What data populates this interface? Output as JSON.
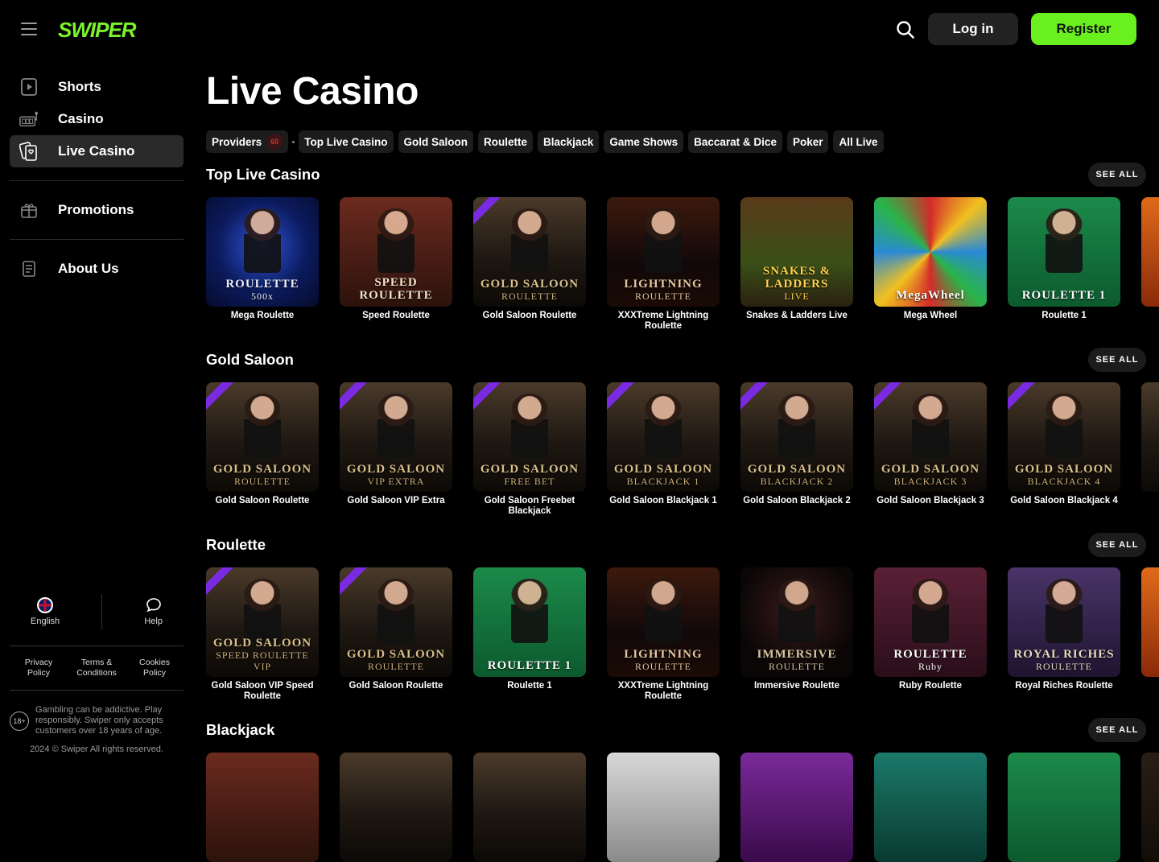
{
  "brand": {
    "logo": "SWIPER"
  },
  "sidebar": {
    "items": [
      {
        "label": "Shorts",
        "icon": "play-square-icon"
      },
      {
        "label": "Casino",
        "icon": "slot-machine-icon"
      },
      {
        "label": "Live Casino",
        "icon": "cards-icon",
        "active": true
      },
      {
        "label": "Promotions",
        "icon": "gift-icon"
      },
      {
        "label": "About Us",
        "icon": "document-icon"
      }
    ],
    "language": "English",
    "help": "Help",
    "privacy": "Privacy Policy",
    "terms": "Terms & Conditions",
    "cookies": "Cookies Policy",
    "age_badge": "18+",
    "disclaimer": "Gambling can be addictive. Play responsibly. Swiper only accepts customers over 18 years of age.",
    "copyright": "2024 © Swiper All rights reserved."
  },
  "header": {
    "login": "Log in",
    "register": "Register"
  },
  "page": {
    "title": "Live Casino",
    "chips": [
      "Providers",
      "Top Live Casino",
      "Gold Saloon",
      "Roulette",
      "Blackjack",
      "Game Shows",
      "Baccarat & Dice",
      "Poker",
      "All Live"
    ],
    "providers_badge": "60"
  },
  "see_all": "SEE ALL",
  "sections": [
    {
      "title": "Top Live Casino",
      "games": [
        {
          "label": "Mega Roulette",
          "art1": "ROULETTE",
          "art2": "500x",
          "theme": "g-blue"
        },
        {
          "label": "Speed Roulette",
          "art1": "SPEED ROULETTE",
          "art2": "",
          "theme": "g-red"
        },
        {
          "label": "Gold Saloon Roulette",
          "art1": "GOLD SALOON",
          "art2": "ROULETTE",
          "theme": "g-gold",
          "exclusive": true
        },
        {
          "label": "XXXTreme Lightning Roulette",
          "art1": "LIGHTNING",
          "art2": "ROULETTE",
          "theme": "g-fire"
        },
        {
          "label": "Snakes & Ladders Live",
          "art1": "SNAKES & LADDERS",
          "art2": "LIVE",
          "theme": "g-snake"
        },
        {
          "label": "Mega Wheel",
          "art1": "MegaWheel",
          "art2": "",
          "theme": "g-wheel"
        },
        {
          "label": "Roulette 1",
          "art1": "ROULETTE 1",
          "art2": "",
          "theme": "g-green"
        }
      ]
    },
    {
      "title": "Gold Saloon",
      "games": [
        {
          "label": "Gold Saloon Roulette",
          "art1": "GOLD SALOON",
          "art2": "ROULETTE",
          "theme": "g-gold",
          "exclusive": true
        },
        {
          "label": "Gold Saloon VIP Extra",
          "art1": "GOLD SALOON",
          "art2": "VIP EXTRA",
          "theme": "g-gold",
          "exclusive": true
        },
        {
          "label": "Gold Saloon Freebet Blackjack",
          "art1": "GOLD SALOON",
          "art2": "FREE BET",
          "theme": "g-gold",
          "exclusive": true
        },
        {
          "label": "Gold Saloon Blackjack 1",
          "art1": "GOLD SALOON",
          "art2": "BLACKJACK 1",
          "theme": "g-gold",
          "exclusive": true
        },
        {
          "label": "Gold Saloon Blackjack 2",
          "art1": "GOLD SALOON",
          "art2": "BLACKJACK 2",
          "theme": "g-gold",
          "exclusive": true
        },
        {
          "label": "Gold Saloon Blackjack 3",
          "art1": "GOLD SALOON",
          "art2": "BLACKJACK 3",
          "theme": "g-gold",
          "exclusive": true
        },
        {
          "label": "Gold Saloon Blackjack 4",
          "art1": "GOLD SALOON",
          "art2": "BLACKJACK 4",
          "theme": "g-gold",
          "exclusive": true
        }
      ]
    },
    {
      "title": "Roulette",
      "games": [
        {
          "label": "Gold Saloon VIP Speed Roulette",
          "art1": "GOLD SALOON",
          "art2": "SPEED ROULETTE VIP",
          "theme": "g-gold",
          "exclusive": true
        },
        {
          "label": "Gold Saloon Roulette",
          "art1": "GOLD SALOON",
          "art2": "ROULETTE",
          "theme": "g-gold",
          "exclusive": true
        },
        {
          "label": "Roulette 1",
          "art1": "ROULETTE 1",
          "art2": "",
          "theme": "g-green"
        },
        {
          "label": "XXXTreme Lightning Roulette",
          "art1": "LIGHTNING",
          "art2": "ROULETTE",
          "theme": "g-fire"
        },
        {
          "label": "Immersive Roulette",
          "art1": "IMMERSIVE",
          "art2": "ROULETTE",
          "theme": "g-immersive"
        },
        {
          "label": "Ruby Roulette",
          "art1": "ROULETTE",
          "art2": "Ruby",
          "theme": "g-ruby"
        },
        {
          "label": "Royal Riches Roulette",
          "art1": "ROYAL RICHES",
          "art2": "ROULETTE",
          "theme": "g-royal"
        }
      ]
    },
    {
      "title": "Blackjack",
      "games": []
    }
  ]
}
